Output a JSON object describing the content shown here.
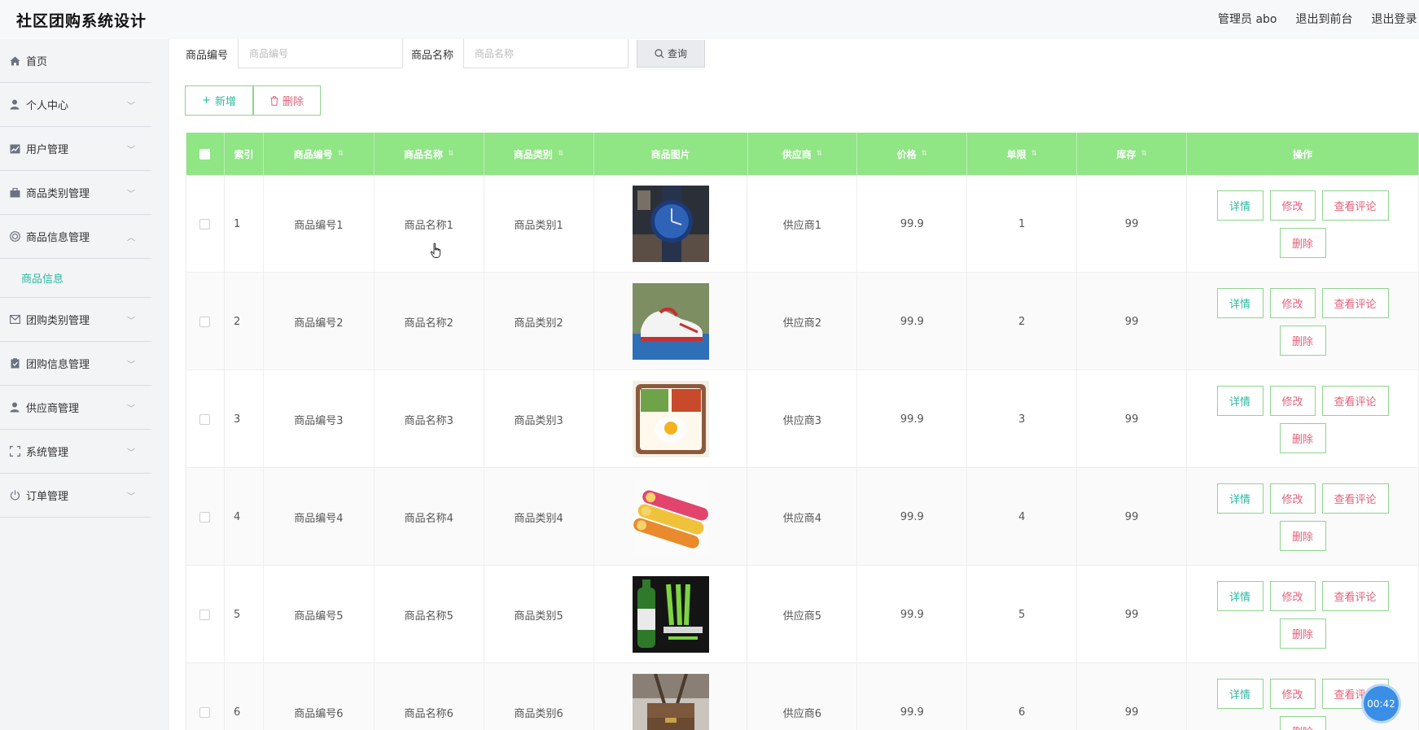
{
  "header": {
    "title": "社区团购系统设计",
    "admin_label": "管理员 abo",
    "front_link": "退出到前台",
    "logout_link": "退出登录"
  },
  "sidebar": {
    "items": [
      {
        "label": "首页",
        "icon": "home-icon"
      },
      {
        "label": "个人中心",
        "icon": "user-icon"
      },
      {
        "label": "用户管理",
        "icon": "chart-icon"
      },
      {
        "label": "商品类别管理",
        "icon": "briefcase-icon"
      },
      {
        "label": "商品信息管理",
        "icon": "target-icon"
      },
      {
        "label": "团购类别管理",
        "icon": "mail-icon"
      },
      {
        "label": "团购信息管理",
        "icon": "clipboard-icon"
      },
      {
        "label": "供应商管理",
        "icon": "user-icon"
      },
      {
        "label": "系统管理",
        "icon": "fullscreen-icon"
      },
      {
        "label": "订单管理",
        "icon": "power-icon"
      }
    ],
    "active_sub": "商品信息"
  },
  "search": {
    "code_label": "商品编号",
    "code_placeholder": "商品编号",
    "name_label": "商品名称",
    "name_placeholder": "商品名称",
    "query_label": "查询"
  },
  "toolbar": {
    "add_label": "新增",
    "delete_label": "删除"
  },
  "table": {
    "headers": [
      "索引",
      "商品编号",
      "商品名称",
      "商品类别",
      "商品图片",
      "供应商",
      "价格",
      "单限",
      "库存",
      "操作"
    ],
    "rows": [
      {
        "idx": "1",
        "code": "商品编号1",
        "name": "商品名称1",
        "cat": "商品类别1",
        "img": "watch-image",
        "sup": "供应商1",
        "price": "99.9",
        "limit": "1",
        "stock": "99"
      },
      {
        "idx": "2",
        "code": "商品编号2",
        "name": "商品名称2",
        "cat": "商品类别2",
        "img": "sneaker-image",
        "sup": "供应商2",
        "price": "99.9",
        "limit": "2",
        "stock": "99"
      },
      {
        "idx": "3",
        "code": "商品编号3",
        "name": "商品名称3",
        "cat": "商品类别3",
        "img": "bento-image",
        "sup": "供应商3",
        "price": "99.9",
        "limit": "3",
        "stock": "99"
      },
      {
        "idx": "4",
        "code": "商品编号4",
        "name": "商品名称4",
        "cat": "商品类别4",
        "img": "chips-image",
        "sup": "供应商4",
        "price": "99.9",
        "limit": "4",
        "stock": "99"
      },
      {
        "idx": "5",
        "code": "商品编号5",
        "name": "商品名称5",
        "cat": "商品类别5",
        "img": "energy-drink-image",
        "sup": "供应商5",
        "price": "99.9",
        "limit": "5",
        "stock": "99"
      },
      {
        "idx": "6",
        "code": "商品编号6",
        "name": "商品名称6",
        "cat": "商品类别6",
        "img": "bag-image",
        "sup": "供应商6",
        "price": "99.9",
        "limit": "6",
        "stock": "99"
      }
    ],
    "ops": {
      "detail": "详情",
      "edit": "修改",
      "review": "查看评论",
      "remove": "删除"
    }
  },
  "timer": "00:42",
  "colors": {
    "accent": "#2bb9a0",
    "header_green": "#90e585",
    "danger": "#e0607a"
  }
}
